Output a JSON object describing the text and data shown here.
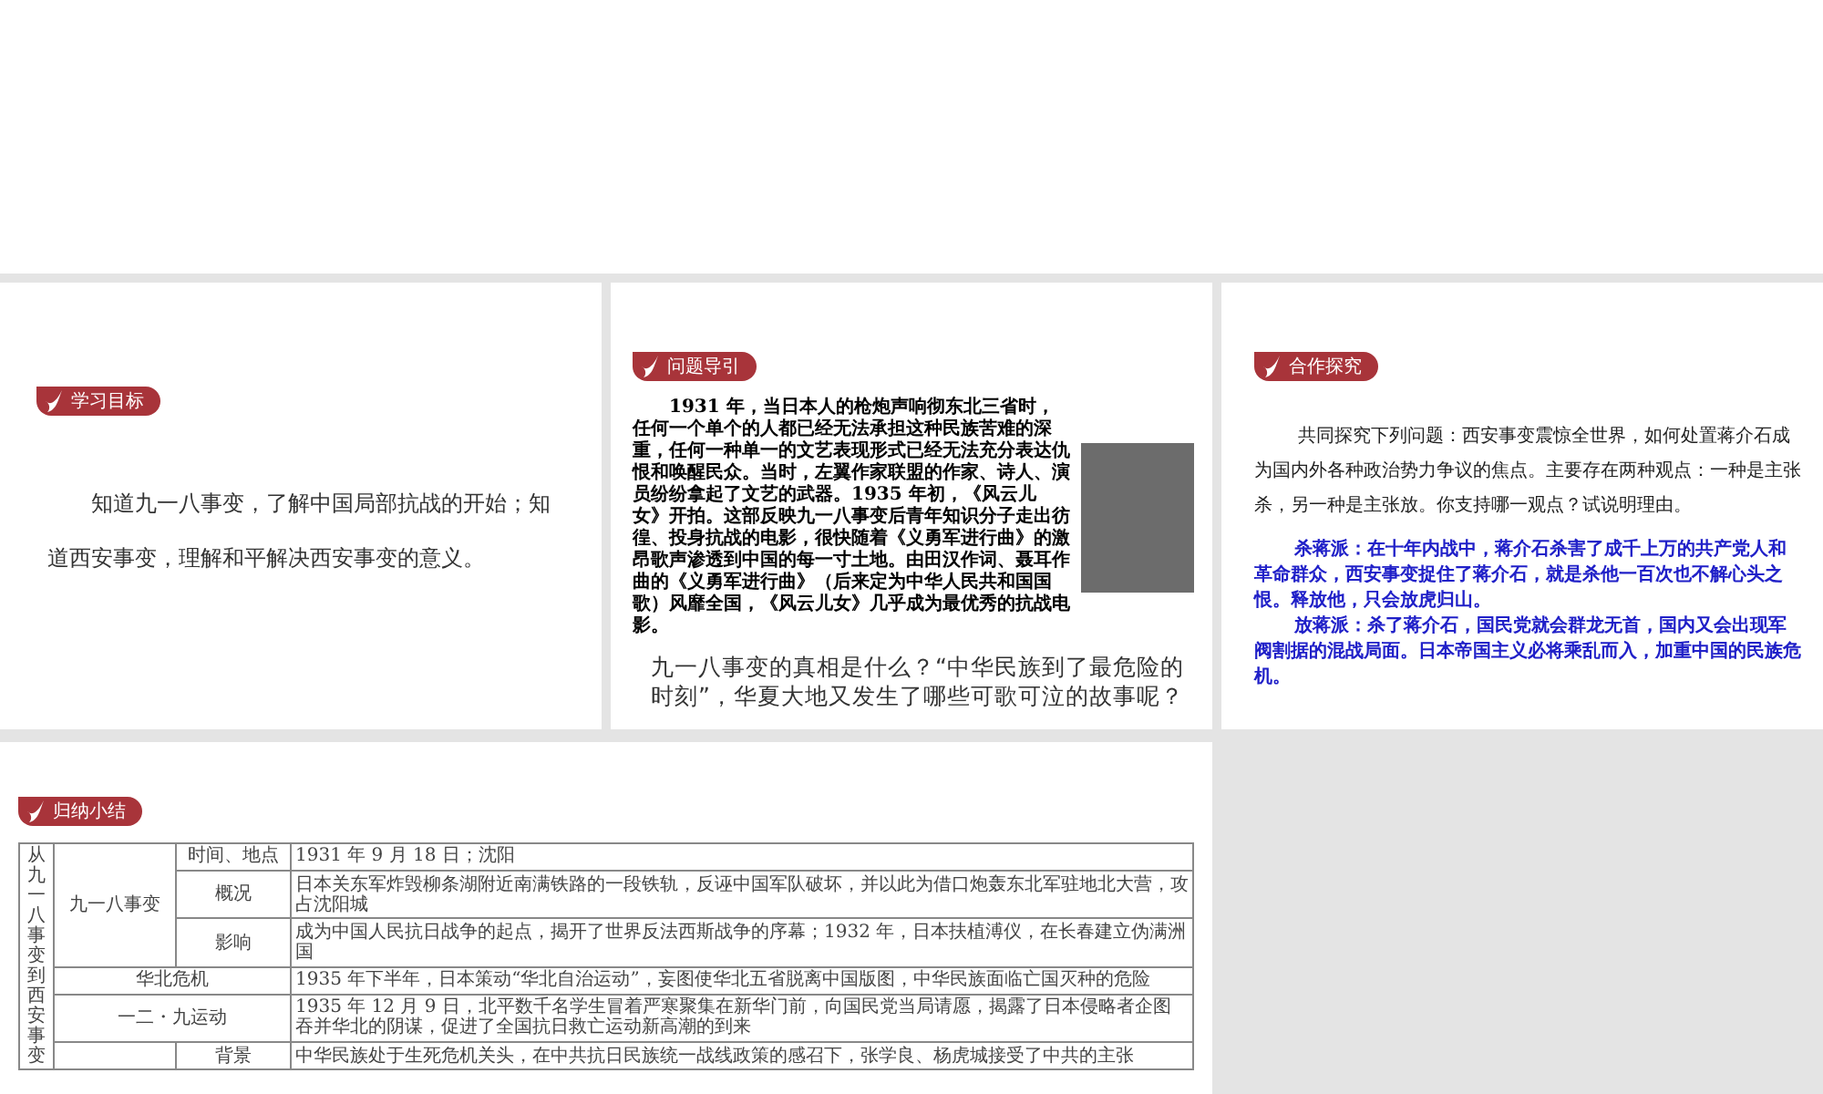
{
  "slides": [
    {
      "kind": "objectives",
      "badge": "学习目标",
      "paragraphs": [
        "知道九一八事变，了解中国局部抗战的开始；知道西安事变，理解和平解决西安事变的意义。"
      ]
    },
    {
      "kind": "intro",
      "badge": "问题导引",
      "passage": "1931 年，当日本人的枪炮声响彻东北三省时，任何一个单个的人都已经无法承担这种民族苦难的深重，任何一种单一的文艺表现形式已经无法充分表达仇恨和唤醒民众。当时，左翼作家联盟的作家、诗人、演员纷纷拿起了文艺的武器。1935 年初，《风云儿女》开拍。这部反映九一八事变后青年知识分子走出彷徨、投身抗战的电影，很快随着《义勇军进行曲》的激昂歌声渗透到中国的每一寸土地。由田汉作词、聂耳作曲的《义勇军进行曲》（后来定为中华人民共和国国歌）风靡全国，《风云儿女》几乎成为最优秀的抗战电影。",
      "question": "九一八事变的真相是什么？“中华民族到了最危险的时刻”，华夏大地又发生了哪些可歌可泣的故事呢？"
    },
    {
      "kind": "discussion",
      "badge": "合作探究",
      "prompt": "共同探究下列问题：西安事变震惊全世界，如何处置蒋介石成为国内外各种政治势力争议的焦点。主要存在两种观点：一种是主张杀，另一种是主张放。你支持哪一观点？试说明理由。",
      "views": [
        "杀蒋派：在十年内战中，蒋介石杀害了成千上万的共产党人和革命群众，西安事变捉住了蒋介石，就是杀他一百次也不解心头之恨。释放他，只会放虎归山。",
        "放蒋派：杀了蒋介石，国民党就会群龙无首，国内又会出现军阀割据的混战局面。日本帝国主义必将乘乱而入，加重中国的民族危机。"
      ]
    },
    {
      "kind": "summary",
      "badge": "归纳小结",
      "table": {
        "side_label": "从九一八事变到西安事变",
        "groups": [
          {
            "label": "九一八事变",
            "items": [
              {
                "topic": "时间、地点",
                "detail": "1931 年 9 月 18 日；沈阳"
              },
              {
                "topic": "概况",
                "detail": "日本关东军炸毁柳条湖附近南满铁路的一段铁轨，反诬中国军队破坏，并以此为借口炮轰东北军驻地北大营，攻占沈阳城"
              },
              {
                "topic": "影响",
                "detail": "成为中国人民抗日战争的起点，揭开了世界反法西斯战争的序幕；1932 年，日本扶植溥仪，在长春建立伪满洲国"
              }
            ]
          },
          {
            "label": "华北危机",
            "detail": "1935 年下半年，日本策动“华北自治运动”，妄图使华北五省脱离中国版图，中华民族面临亡国灭种的危险"
          },
          {
            "label": "一二・九运动",
            "detail": "1935 年 12 月 9 日，北平数千名学生冒着严寒聚集在新华门前，向国民党当局请愿，揭露了日本侵略者企图吞并华北的阴谋，促进了全国抗日救亡运动新高潮的到来"
          },
          {
            "items": [
              {
                "topic": "背景",
                "detail": "中华民族处于生死危机关头，在中共抗日民族统一战线政策的感召下，张学良、杨虎城接受了中共的主张"
              }
            ]
          }
        ]
      }
    }
  ]
}
